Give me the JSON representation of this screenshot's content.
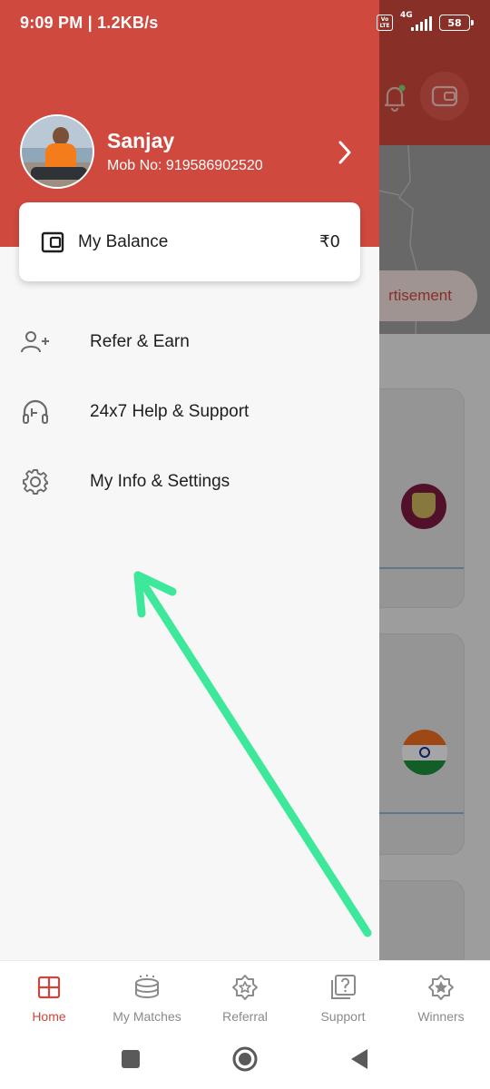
{
  "status_bar": {
    "time": "9:09 PM | 1.2KB/s",
    "network": "4G",
    "volte": "Vo LTE",
    "battery": "58"
  },
  "background": {
    "ad_text": "rtisement"
  },
  "drawer": {
    "user": {
      "name": "Sanjay",
      "mobile": "Mob No: 919586902520"
    },
    "balance": {
      "label": "My Balance",
      "amount": "₹0"
    },
    "menu": [
      {
        "label": "Refer & Earn",
        "icon": "add-user-icon"
      },
      {
        "label": "24x7 Help & Support",
        "icon": "headset-icon"
      },
      {
        "label": "My Info & Settings",
        "icon": "gear-icon"
      }
    ]
  },
  "bottom_nav": {
    "items": [
      {
        "label": "Home",
        "icon": "home-grid-icon",
        "active": true
      },
      {
        "label": "My Matches",
        "icon": "stadium-icon",
        "active": false
      },
      {
        "label": "Referral",
        "icon": "star-badge-icon",
        "active": false
      },
      {
        "label": "Support",
        "icon": "question-icon",
        "active": false
      },
      {
        "label": "Winners",
        "icon": "trophy-star-icon",
        "active": false
      }
    ]
  },
  "colors": {
    "brand_red": "#d0493e",
    "active_nav": "#c9473c",
    "arrow_green": "#3ee89a"
  }
}
